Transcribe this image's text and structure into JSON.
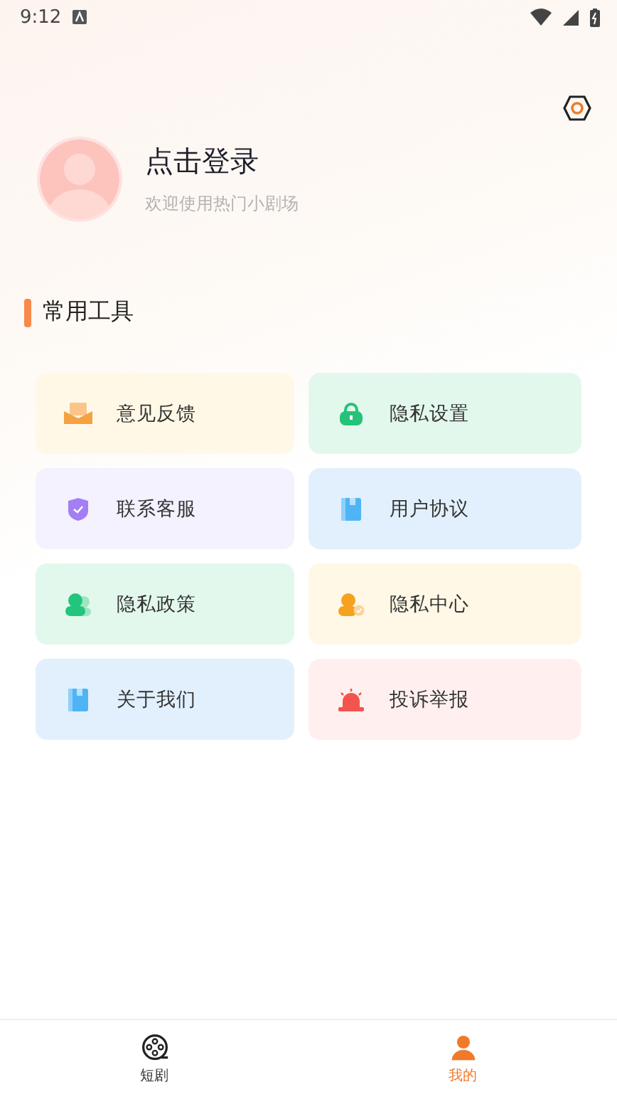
{
  "status_bar": {
    "time": "9:12"
  },
  "profile": {
    "title": "点击登录",
    "subtitle": "欢迎使用热门小剧场"
  },
  "section": {
    "title": "常用工具"
  },
  "tools": [
    {
      "label": "意见反馈",
      "kind": "mail"
    },
    {
      "label": "隐私设置",
      "kind": "lock"
    },
    {
      "label": "联系客服",
      "kind": "shield"
    },
    {
      "label": "用户协议",
      "kind": "book"
    },
    {
      "label": "隐私政策",
      "kind": "users"
    },
    {
      "label": "隐私中心",
      "kind": "person"
    },
    {
      "label": "关于我们",
      "kind": "book"
    },
    {
      "label": "投诉举报",
      "kind": "alarm"
    }
  ],
  "bottom_nav": [
    {
      "label": "短剧",
      "kind": "film",
      "selected": false
    },
    {
      "label": "我的",
      "kind": "person",
      "selected": true
    }
  ]
}
